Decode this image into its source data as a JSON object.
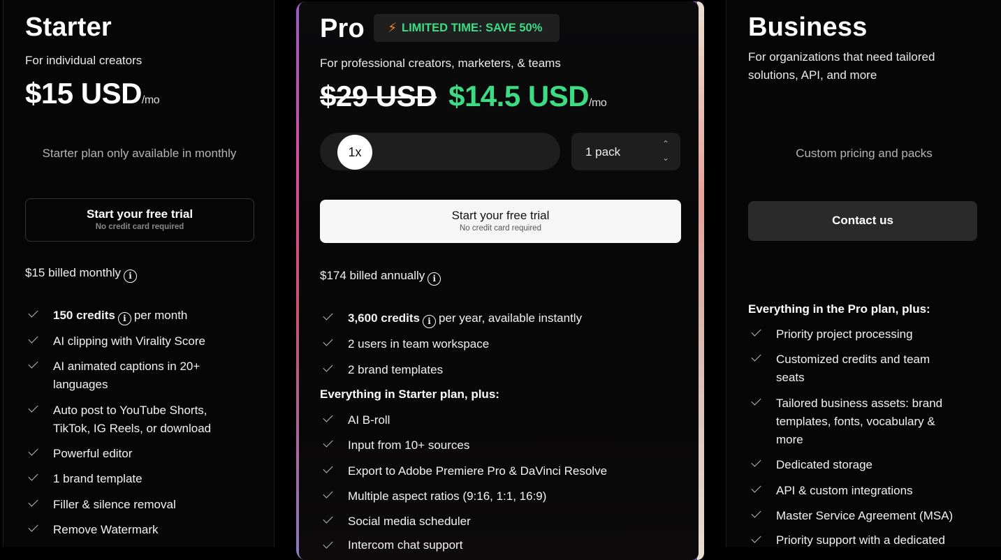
{
  "starter": {
    "title": "Starter",
    "subtitle": "For individual creators",
    "price": "$15 USD",
    "per": "/mo",
    "note": "Starter plan only available in monthly",
    "cta_label": "Start your free trial",
    "cta_sub": "No credit card required",
    "billing": "$15 billed monthly",
    "features": [
      {
        "bold": "150 credits",
        "after": "per month",
        "info": true
      },
      {
        "text": "AI clipping with Virality Score"
      },
      {
        "text": "AI animated captions in 20+",
        "text2": "languages"
      },
      {
        "text": "Auto post to YouTube Shorts,",
        "text2": "TikTok, IG Reels, or download"
      },
      {
        "text": "Powerful editor"
      },
      {
        "text": "1 brand template"
      },
      {
        "text": "Filler & silence removal"
      },
      {
        "text": "Remove Watermark"
      }
    ]
  },
  "pro": {
    "title": "Pro",
    "badge": "LIMITED TIME: SAVE 50%",
    "subtitle": "For professional creators, marketers, & teams",
    "old_price": "$29 USD",
    "price": "$14.5 USD",
    "per": "/mo",
    "multiplier": "1x",
    "pack_value": "1 pack",
    "cta_label": "Start your free trial",
    "cta_sub": "No credit card required",
    "billing": "$174 billed annually",
    "features": [
      {
        "bold": "3,600 credits",
        "after": "per year, available instantly",
        "info": true
      },
      {
        "text": "2 users in team workspace"
      },
      {
        "text": "2 brand templates"
      }
    ],
    "section": "Everything in Starter plan, plus:",
    "features2": [
      {
        "text": "AI B-roll"
      },
      {
        "text": "Input from 10+ sources"
      },
      {
        "text": "Export to Adobe Premiere Pro & DaVinci Resolve"
      },
      {
        "text": "Multiple aspect ratios (9:16, 1:1, 16:9)"
      },
      {
        "text": "Social media scheduler"
      },
      {
        "text": "Intercom chat support"
      }
    ]
  },
  "business": {
    "title": "Business",
    "subtitle_line1": "For organizations that need tailored",
    "subtitle_line2": "solutions, API, and more",
    "note": "Custom pricing and packs",
    "cta_label": "Contact us",
    "section": "Everything in the Pro plan, plus:",
    "features": [
      {
        "text": "Priority project processing"
      },
      {
        "text": "Customized credits and team",
        "text2": "seats"
      },
      {
        "text": "Tailored business assets: brand",
        "text2": "templates, fonts, vocabulary &",
        "text3": "more"
      },
      {
        "text": "Dedicated storage"
      },
      {
        "text": "API & custom integrations"
      },
      {
        "text": "Master Service Agreement (MSA)"
      },
      {
        "text": "Priority support with a dedicated"
      }
    ]
  },
  "colors": {
    "accent_green": "#3ddc84",
    "badge_text": "#3ddc84",
    "bolt": "#f0802a"
  },
  "icons": {
    "check": "check-icon",
    "info": "info-icon",
    "bolt": "lightning-icon",
    "stepper": "chevron-updown-icon"
  }
}
